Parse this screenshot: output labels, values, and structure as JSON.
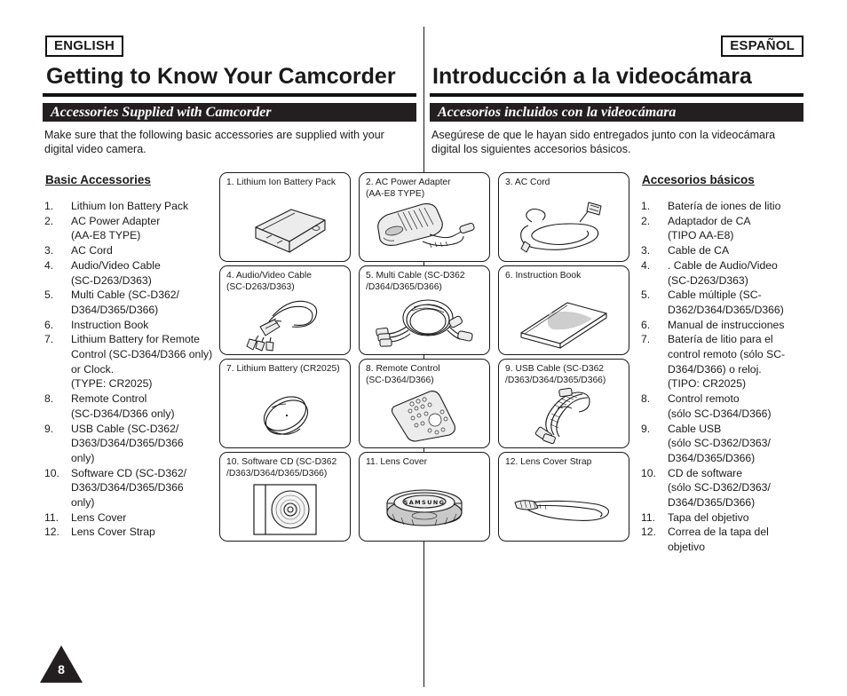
{
  "badges": {
    "english": "ENGLISH",
    "spanish": "ESPAÑOL"
  },
  "titles": {
    "english": "Getting to Know Your Camcorder",
    "spanish": "Introducción a la videocámara"
  },
  "section_bars": {
    "english": "Accessories Supplied with Camcorder",
    "spanish": "Accesorios incluidos con la videocámara"
  },
  "intro": {
    "english": "Make sure that the following basic accessories are supplied with your digital video camera.",
    "spanish": "Asegúrese de que le hayan sido entregados junto con la videocámara digital los siguientes accesorios básicos."
  },
  "list_headings": {
    "english": "Basic Accessories",
    "spanish": "Accesorios básicos"
  },
  "list_english": [
    {
      "num": "1.",
      "text": "Lithium Ion Battery Pack"
    },
    {
      "num": "2.",
      "text": "AC Power Adapter\n(AA-E8 TYPE)"
    },
    {
      "num": "3.",
      "text": "AC Cord"
    },
    {
      "num": "4.",
      "text": "Audio/Video Cable\n(SC-D263/D363)"
    },
    {
      "num": "5.",
      "text": "Multi Cable (SC-D362/\nD364/D365/D366)"
    },
    {
      "num": "6.",
      "text": "Instruction Book"
    },
    {
      "num": "7.",
      "text": "Lithium Battery for Remote Control (SC-D364/D366 only) or Clock.\n(TYPE: CR2025)"
    },
    {
      "num": "8.",
      "text": "Remote Control\n(SC-D364/D366 only)"
    },
    {
      "num": "9.",
      "text": "USB Cable (SC-D362/\nD363/D364/D365/D366\nonly)"
    },
    {
      "num": "10.",
      "text": "Software CD (SC-D362/\nD363/D364/D365/D366\nonly)"
    },
    {
      "num": "11.",
      "text": "Lens Cover"
    },
    {
      "num": "12.",
      "text": "Lens Cover Strap"
    }
  ],
  "list_spanish": [
    {
      "num": "1.",
      "text": "Batería de iones de litio"
    },
    {
      "num": "2.",
      "text": "Adaptador de CA\n(TIPO AA-E8)"
    },
    {
      "num": "3.",
      "text": "Cable de CA"
    },
    {
      "num": "4.",
      "text": ". Cable de Audio/Video\n(SC-D263/D363)"
    },
    {
      "num": "5.",
      "text": "Cable múltiple (SC-\nD362/D364/D365/D366)"
    },
    {
      "num": "6.",
      "text": "Manual de instrucciones"
    },
    {
      "num": "7.",
      "text": "Batería de litio para el control remoto (sólo SC-D364/D366) o reloj.\n(TIPO: CR2025)"
    },
    {
      "num": "8.",
      "text": "Control remoto\n(sólo SC-D364/D366)"
    },
    {
      "num": "9.",
      "text": "Cable USB\n(sólo SC-D362/D363/\nD364/D365/D366)"
    },
    {
      "num": "10.",
      "text": "CD de software\n(sólo SC-D362/D363/\nD364/D365/D366)"
    },
    {
      "num": "11.",
      "text": "Tapa del objetivo"
    },
    {
      "num": "12.",
      "text": "Correa de la tapa del objetivo"
    }
  ],
  "grid": [
    {
      "caption": "1. Lithium Ion Battery Pack",
      "icon": "battery-pack-illustration"
    },
    {
      "caption": "2. AC Power Adapter\n    (AA-E8 TYPE)",
      "icon": "ac-power-adapter-illustration"
    },
    {
      "caption": "3. AC Cord",
      "icon": "ac-cord-illustration"
    },
    {
      "caption": "4. Audio/Video Cable\n    (SC-D263/D363)",
      "icon": "av-cable-illustration"
    },
    {
      "caption": "5. Multi Cable (SC-D362\n    /D364/D365/D366)",
      "icon": "multi-cable-illustration"
    },
    {
      "caption": "6. Instruction Book",
      "icon": "instruction-book-illustration"
    },
    {
      "caption": "7. Lithium Battery (CR2025)",
      "icon": "coin-battery-illustration"
    },
    {
      "caption": "8. Remote Control\n    (SC-D364/D366)",
      "icon": "remote-control-illustration"
    },
    {
      "caption": "9. USB Cable (SC-D362\n    /D363/D364/D365/D366)",
      "icon": "usb-cable-illustration"
    },
    {
      "caption": "10. Software CD (SC-D362\n     /D363/D364/D365/D366)",
      "icon": "software-cd-illustration"
    },
    {
      "caption": "11. Lens Cover",
      "icon": "lens-cover-illustration"
    },
    {
      "caption": "12. Lens Cover Strap",
      "icon": "lens-cover-strap-illustration"
    }
  ],
  "page_number": "8",
  "colors": {
    "ink": "#1a1a1a",
    "bar": "#231f20",
    "paper": "#ffffff",
    "art_fill": "#e8e8e8"
  }
}
